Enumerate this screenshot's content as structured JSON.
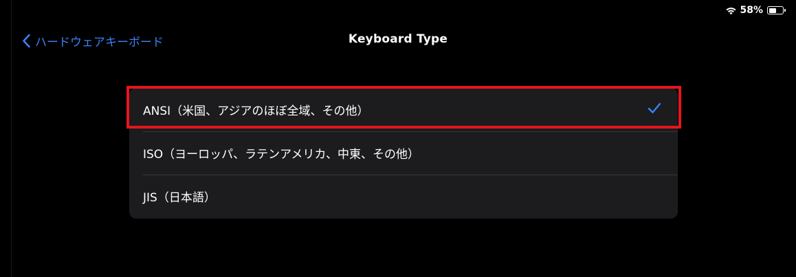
{
  "status_bar": {
    "wifi_icon": "wifi-icon",
    "battery_percent": "58%",
    "battery_level": 0.58,
    "battery_icon": "battery-icon"
  },
  "nav": {
    "back_label": "ハードウェアキーボード",
    "back_icon": "chevron-left-icon",
    "title": "Keyboard Type"
  },
  "options": [
    {
      "label": "ANSI（米国、アジアのほぼ全域、その他）",
      "selected": true
    },
    {
      "label": "ISO（ヨーロッパ、ラテンアメリカ、中東、その他）",
      "selected": false
    },
    {
      "label": "JIS（日本語）",
      "selected": false
    }
  ],
  "colors": {
    "accent": "#3b82f6",
    "highlight": "#e8141c",
    "list_background": "#1c1c1e",
    "background": "#000000"
  }
}
